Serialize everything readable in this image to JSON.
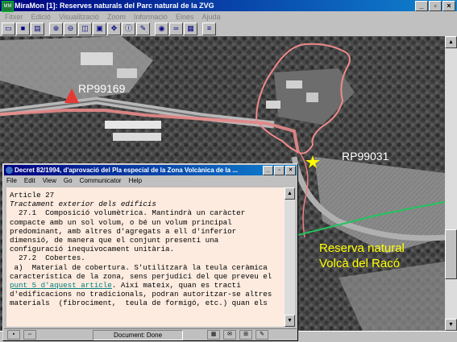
{
  "window": {
    "title": "MiraMon [1]:  Reserves naturals del Parc natural de la ZVG"
  },
  "menu": [
    "Fitxer",
    "Edició",
    "Visualització",
    "Zoom",
    "Informació",
    "Eines",
    "Ajuda"
  ],
  "map": {
    "labels": {
      "rp1": "RP99169",
      "rp2": "RP99031",
      "reserve_line1": "Reserva natural",
      "reserve_line2": "Volcà del Racó"
    }
  },
  "browser": {
    "title": "Decret 82/1994, d'aprovació del Pla especial de la Zona Volcànica de la ...",
    "menu": [
      "File",
      "Edit",
      "View",
      "Go",
      "Communicator",
      "Help"
    ],
    "status": "Document: Done",
    "content": {
      "heading": "Article 27",
      "subheading": "Tractament exterior dels edificis",
      "lines": [
        "  27.1  Composició volumètrica. Mantindrà un caràcter",
        "compacte amb un sol volum, o bé un volum principal",
        "predominant, amb altres d'agregats a ell d'inferior",
        "dimensió, de manera que el conjunt presenti una",
        "configuració inequívocament unitària.",
        "  27.2  Cobertes.",
        " a)  Material de cobertura. S'utilitzarà la teula ceràmica",
        "característica de la zona, sens perjudici del que preveu el"
      ],
      "line_link_pre": "",
      "link": "punt 5 d'aquest article",
      "line_link_post": ". Aixi mateix, quan es tracti",
      "lines_after": [
        "d'edificacions no tradicionals, podran autoritzar-se altres",
        "materials  (fibrociment,  teula de formigó, etc.) quan els"
      ]
    }
  },
  "colors": {
    "titlebar": "#000080",
    "boundary": "#f08080",
    "reserve_boundary": "#22c55e",
    "marker_red": "#e53935",
    "marker_star": "#ffff00",
    "browser_bg": "#fdebdf"
  }
}
